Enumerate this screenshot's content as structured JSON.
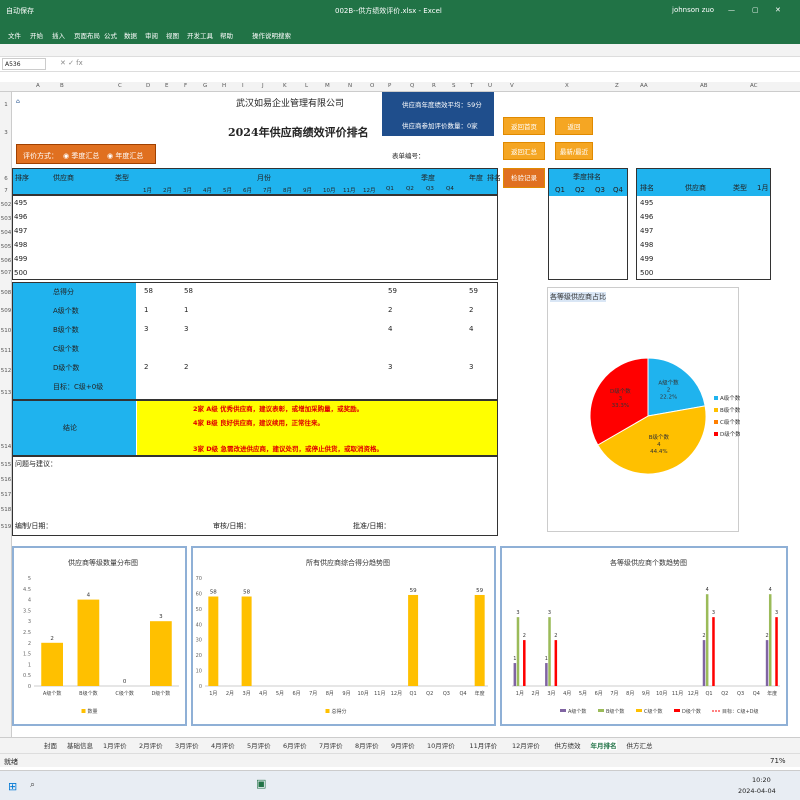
{
  "window": {
    "title": "002B--供方绩效评价.xlsx - Excel",
    "user": "johnson zuo"
  },
  "ribbon": {
    "tabs": [
      "文件",
      "开始",
      "插入",
      "页面布局",
      "公式",
      "数据",
      "审阅",
      "视图",
      "开发工具",
      "帮助",
      "操作说明搜索"
    ]
  },
  "formula": {
    "cell": "A536"
  },
  "colors": {
    "excel_green": "#217346",
    "orange": "#f5a623",
    "cyan": "#1fb3ee",
    "navy": "#1f4e8c",
    "yellow": "#ffff00",
    "red_text": "#e00000"
  },
  "sheet": {
    "company": "武汉如易企业管理有限公司",
    "title": "2024年供应商绩效评价排名",
    "avg_label": "供应商年度绩效平均：",
    "avg_value": "59分",
    "count_label": "供应商参加评价数量：",
    "count_value": "0家",
    "method_label": "评价方式：",
    "method_opt1": "季度汇总",
    "method_opt2": "年度汇总",
    "form_no": "表单编号：",
    "btn_first": "返回首页",
    "btn_back": "返回",
    "btn_summary": "返回汇总",
    "btn_latest": "最新/最近",
    "btn_check": "检验记录",
    "hdr_rank": "排序",
    "hdr_supplier": "供应商",
    "hdr_type": "类型",
    "hdr_month": "月份",
    "hdr_quarter": "季度",
    "hdr_year": "年度",
    "hdr_rank2": "排名",
    "months": [
      "1月",
      "2月",
      "3月",
      "4月",
      "5月",
      "6月",
      "7月",
      "8月",
      "9月",
      "10月",
      "11月",
      "12月"
    ],
    "quarters": [
      "Q1",
      "Q2",
      "Q3",
      "Q4"
    ],
    "rank_rows": [
      "495",
      "496",
      "497",
      "498",
      "499",
      "500"
    ],
    "q_rank_title": "季度排名",
    "right_rank": "排名",
    "right_supplier": "供应商",
    "right_type": "类型",
    "right_month": "1月",
    "summary_rows": [
      {
        "label": "总得分",
        "m1": "58",
        "m3": "58",
        "q1": "59",
        "y": "59"
      },
      {
        "label": "A级个数",
        "m1": "1",
        "m3": "1",
        "q1": "2",
        "y": "2"
      },
      {
        "label": "B级个数",
        "m1": "3",
        "m3": "3",
        "q1": "4",
        "y": "4"
      },
      {
        "label": "C级个数",
        "m1": "",
        "m3": "",
        "q1": "",
        "y": ""
      },
      {
        "label": "D级个数",
        "m1": "2",
        "m3": "2",
        "q1": "3",
        "y": "3"
      },
      {
        "label": "目标：C级+0级",
        "m1": "",
        "m3": "",
        "q1": "",
        "y": ""
      }
    ],
    "conclusion_label": "结论",
    "conclusion_lines": [
      "2家 A级 优秀供应商，建议表彰，或增加采购量，或奖励。",
      "4家 B级 良好供应商，建议续用，正常往来。",
      "3家 D级 急需改进供应商，建议处罚，或停止供货，或取消资格。"
    ],
    "issues": "问题与建议：",
    "sign1": "编制/日期：",
    "sign2": "审核/日期：",
    "sign3": "批准/日期："
  },
  "chart_data": [
    {
      "type": "pie",
      "title": "各等级供应商占比",
      "categories": [
        "A级个数",
        "B级个数",
        "C级个数",
        "D级个数"
      ],
      "values": [
        2,
        4,
        0,
        3
      ],
      "labels": [
        "A级个数\n2\n22.2%",
        "B级个数\n4\n44.4%",
        "",
        "D级个数\n3\n33.3%"
      ],
      "colors": [
        "#1fb3ee",
        "#ffc000",
        "#ff7f00",
        "#ff0000"
      ],
      "legend": "right"
    },
    {
      "type": "bar",
      "title": "供应商等级数量分布图",
      "categories": [
        "A级个数",
        "B级个数",
        "C级个数",
        "D级个数"
      ],
      "values": [
        2,
        4,
        0,
        3
      ],
      "series_name": "数量",
      "ylim": [
        0,
        5
      ],
      "yticks": [
        "0",
        "0.5",
        "1",
        "1.5",
        "2",
        "2.5",
        "3",
        "3.5",
        "4",
        "4.5",
        "5"
      ],
      "color": "#ffc000",
      "legend": "bottom"
    },
    {
      "type": "bar",
      "title": "所有供应商综合得分趋势图",
      "categories": [
        "1月",
        "2月",
        "3月",
        "4月",
        "5月",
        "6月",
        "7月",
        "8月",
        "9月",
        "10月",
        "11月",
        "12月",
        "Q1",
        "Q2",
        "Q3",
        "Q4",
        "年度"
      ],
      "values": [
        58,
        null,
        58,
        null,
        null,
        null,
        null,
        null,
        null,
        null,
        null,
        null,
        59,
        null,
        null,
        null,
        59
      ],
      "series_name": "总得分",
      "ylim": [
        0,
        70
      ],
      "yticks": [
        "0",
        "10",
        "20",
        "30",
        "40",
        "50",
        "60",
        "70"
      ],
      "color": "#ffc000",
      "legend": "bottom"
    },
    {
      "type": "bar",
      "title": "各等级供应商个数趋势图",
      "categories": [
        "1月",
        "2月",
        "3月",
        "4月",
        "5月",
        "6月",
        "7月",
        "8月",
        "9月",
        "10月",
        "11月",
        "12月",
        "Q1",
        "Q2",
        "Q3",
        "Q4",
        "年度"
      ],
      "series": [
        {
          "name": "A级个数",
          "color": "#8064a2",
          "values": [
            1,
            null,
            1,
            null,
            null,
            null,
            null,
            null,
            null,
            null,
            null,
            null,
            2,
            null,
            null,
            null,
            2
          ]
        },
        {
          "name": "B级个数",
          "color": "#9bbb59",
          "values": [
            3,
            null,
            3,
            null,
            null,
            null,
            null,
            null,
            null,
            null,
            null,
            null,
            4,
            null,
            null,
            null,
            4
          ]
        },
        {
          "name": "C级个数",
          "color": "#ffc000",
          "values": [
            null,
            null,
            null,
            null,
            null,
            null,
            null,
            null,
            null,
            null,
            null,
            null,
            null,
            null,
            null,
            null,
            null
          ]
        },
        {
          "name": "D级个数",
          "color": "#ff0000",
          "values": [
            2,
            null,
            2,
            null,
            null,
            null,
            null,
            null,
            null,
            null,
            null,
            null,
            3,
            null,
            null,
            null,
            3
          ]
        }
      ],
      "extra_legend": "目标：C级+D级",
      "ylim": [
        0,
        4
      ],
      "legend": "bottom"
    }
  ],
  "tabs": [
    "封面",
    "基础信息",
    "1月评价",
    "2月评价",
    "3月评价",
    "4月评价",
    "5月评价",
    "6月评价",
    "7月评价",
    "8月评价",
    "9月评价",
    "10月评价",
    "11月评价",
    "12月评价",
    "供方绩效",
    "年月排名",
    "供方汇总"
  ],
  "active_tab": "年月排名",
  "status": {
    "left": "就绪",
    "zoom": "71%"
  },
  "taskbar": {
    "time": "10:20",
    "date": "2024-04-04"
  }
}
